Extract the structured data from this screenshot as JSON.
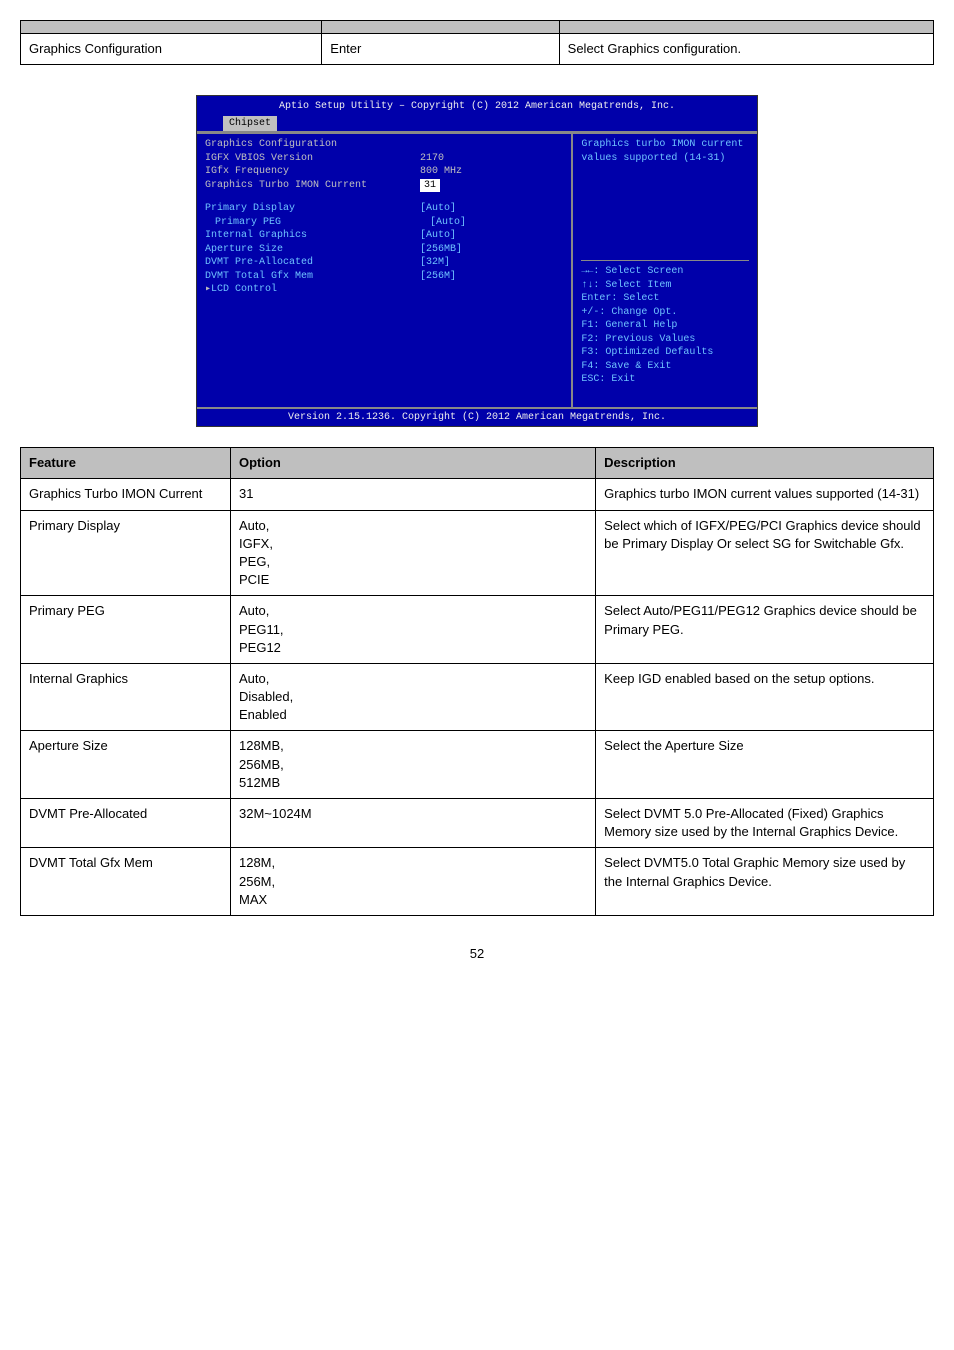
{
  "upper_table": {
    "rows": [
      {
        "feature": "Graphics Configuration",
        "option": "Enter",
        "description": "Select Graphics configuration."
      }
    ]
  },
  "bios": {
    "header_title": "Aptio Setup Utility – Copyright (C) 2012 American Megatrends, Inc.",
    "tab": "Chipset",
    "section_title": "Graphics Configuration",
    "info_rows": [
      {
        "k": "IGFX VBIOS Version",
        "v": "2170"
      },
      {
        "k": "IGfx Frequency",
        "v": "800 MHz"
      }
    ],
    "selected_row": {
      "k": "Graphics Turbo IMON Current",
      "v": "31"
    },
    "option_rows": [
      {
        "k": "Primary Display",
        "v": "[Auto]",
        "sub": false
      },
      {
        "k": "Primary PEG",
        "v": "[Auto]",
        "sub": true
      },
      {
        "k": "Internal Graphics",
        "v": "[Auto]",
        "sub": false
      },
      {
        "k": "Aperture Size",
        "v": "[256MB]",
        "sub": false
      },
      {
        "k": "DVMT Pre-Allocated",
        "v": "[32M]",
        "sub": false
      },
      {
        "k": "DVMT Total Gfx Mem",
        "v": "[256M]",
        "sub": false
      }
    ],
    "submenu_row": "LCD Control",
    "help_text": "Graphics turbo IMON current values supported (14-31)",
    "keys": [
      "→←: Select Screen",
      "↑↓: Select Item",
      "Enter: Select",
      "+/-: Change Opt.",
      "F1: General Help",
      "F2: Previous Values",
      "F3: Optimized Defaults",
      "F4: Save & Exit",
      "ESC: Exit"
    ],
    "footer": "Version 2.15.1236. Copyright (C) 2012 American Megatrends, Inc."
  },
  "lower_table": {
    "headers": [
      "Feature",
      "Option",
      "Description"
    ],
    "rows": [
      {
        "f": "Graphics Turbo IMON Current",
        "o": "31",
        "d": "Graphics turbo IMON current values supported (14-31)"
      },
      {
        "f": "Primary Display",
        "o": "Auto,\nIGFX,\nPEG,\nPCIE",
        "d": "Select which of IGFX/PEG/PCI Graphics device should be Primary Display Or select SG for Switchable Gfx."
      },
      {
        "f": "Primary PEG",
        "o": "Auto,\nPEG11,\nPEG12",
        "d": "Select Auto/PEG11/PEG12 Graphics device should be Primary PEG."
      },
      {
        "f": "Internal Graphics",
        "o": "Auto,\nDisabled,\nEnabled",
        "d": "Keep IGD enabled based on the setup options."
      },
      {
        "f": "Aperture Size",
        "o": "128MB,\n256MB,\n512MB",
        "d": "Select the Aperture Size"
      },
      {
        "f": "DVMT Pre-Allocated",
        "o": "32M~1024M",
        "d": "Select DVMT 5.0 Pre-Allocated (Fixed) Graphics Memory size used by the Internal Graphics Device."
      },
      {
        "f": "DVMT Total Gfx Mem",
        "o": "128M,\n256M,\nMAX",
        "d": "Select DVMT5.0 Total Graphic Memory size used by the Internal Graphics Device."
      }
    ]
  },
  "page_number": "52"
}
